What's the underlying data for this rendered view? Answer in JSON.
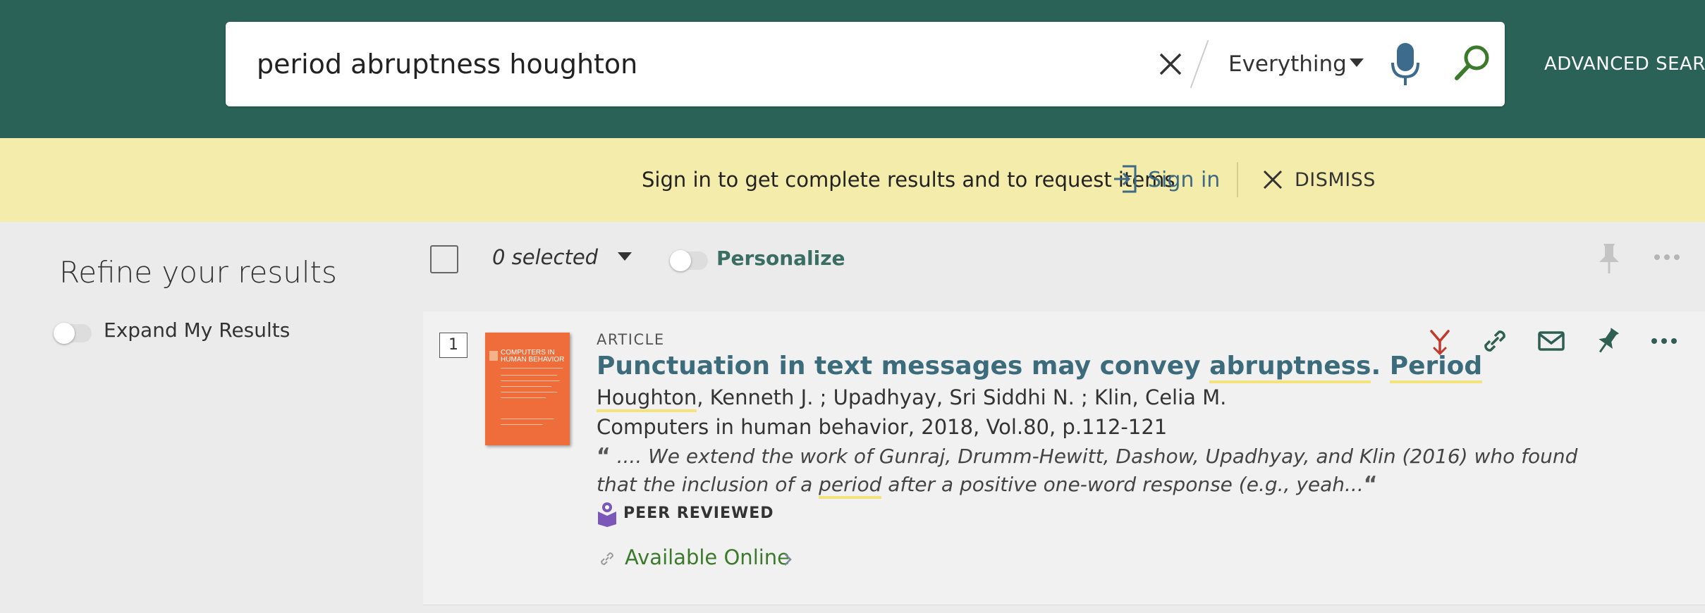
{
  "header": {
    "search": {
      "query": "period abruptness houghton",
      "scope": "Everything"
    },
    "advanced_search_label": "ADVANCED SEARCH",
    "colors": {
      "header_bg": "#2a6257",
      "search_green": "#3a7a2a",
      "mic_blue": "#3d6b8c"
    }
  },
  "banner": {
    "message": "Sign in to get complete results and to request items",
    "sign_in_label": "Sign in",
    "dismiss_label": "DISMISS",
    "colors": {
      "bg": "#f4ecaa",
      "link": "#3e6a85"
    }
  },
  "facets": {
    "title": "Refine your results",
    "expand_label": "Expand My Results"
  },
  "toolbar": {
    "selected_text": "0 selected",
    "personalize_label": "Personalize"
  },
  "results": [
    {
      "number": "1",
      "type": "ARTICLE",
      "title_parts": [
        "Punctuation in text messages may convey ",
        "abruptness",
        ". ",
        "Period"
      ],
      "author_first": "Houghton",
      "authors_rest": ", Kenneth J. ; Upadhyay, Sri Siddhi N. ; Klin, Celia M.",
      "source": "Computers in human behavior, 2018, Vol.80, p.112-121",
      "snippet_open_quote": "“",
      "snippet_before": " .... We extend the work of Gunraj, Drumm-Hewitt, Dashow, Upadhyay, and Klin (2016) who found that the inclusion of a ",
      "snippet_highlight": "period",
      "snippet_after": " after a positive one-word response (e.g., yeah...",
      "snippet_close_quote": "“",
      "peer_reviewed_label": "PEER REVIEWED",
      "availability_label": "Available Online",
      "cover": {
        "title_line1": "COMPUTERS IN",
        "title_line2": "HUMAN BEHAVIOR",
        "color": "#ef6d3a"
      },
      "highlight_color": "#f4e37a",
      "title_color": "#3c6c7c"
    }
  ]
}
